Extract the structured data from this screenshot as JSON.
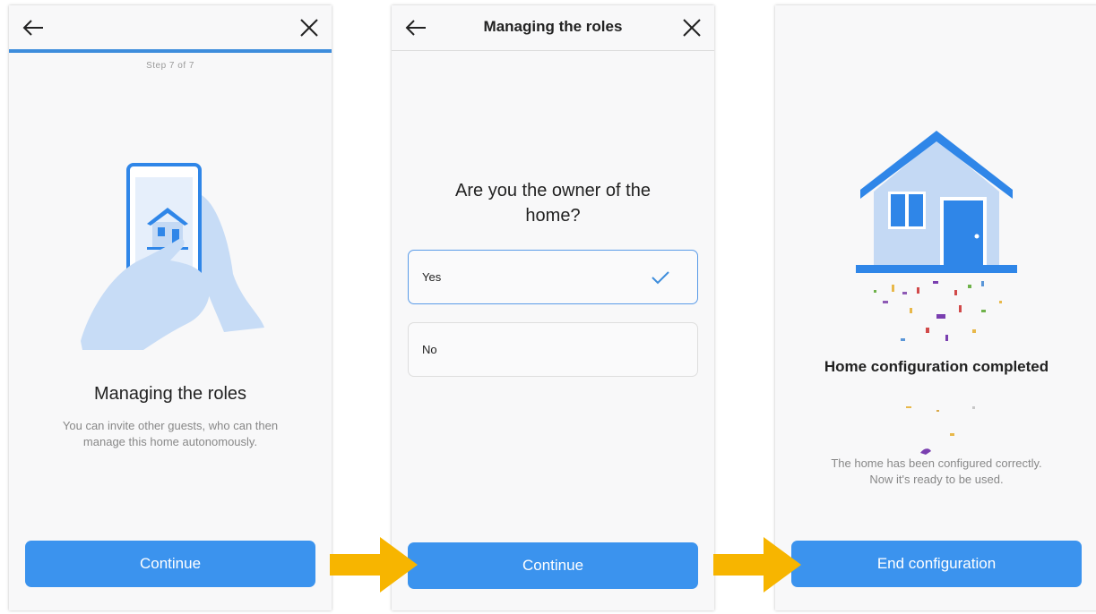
{
  "screen1": {
    "step_text": "Step 7 of 7",
    "title": "Managing the roles",
    "subtitle_line1": "You can invite other guests, who can then",
    "subtitle_line2": "manage this home autonomously.",
    "continue_label": "Continue"
  },
  "screen2": {
    "header_title": "Managing the roles",
    "question_line1": "Are you the owner of the",
    "question_line2": "home?",
    "options": [
      {
        "label": "Yes",
        "selected": true
      },
      {
        "label": "No",
        "selected": false
      }
    ],
    "continue_label": "Continue"
  },
  "screen3": {
    "title": "Home configuration completed",
    "subtitle_line1": "The home has been configured correctly.",
    "subtitle_line2": "Now it's ready to be used.",
    "end_label": "End configuration"
  },
  "colors": {
    "accent": "#3b93ee",
    "progress": "#3e8ddc",
    "flow_arrow": "#f7b500",
    "house_light": "#c4d9f4",
    "house_dark": "#2f86e8"
  },
  "icons": [
    "back-arrow-icon",
    "close-icon",
    "checkmark-icon",
    "phone-house-illustration",
    "house-illustration",
    "flow-arrow"
  ]
}
